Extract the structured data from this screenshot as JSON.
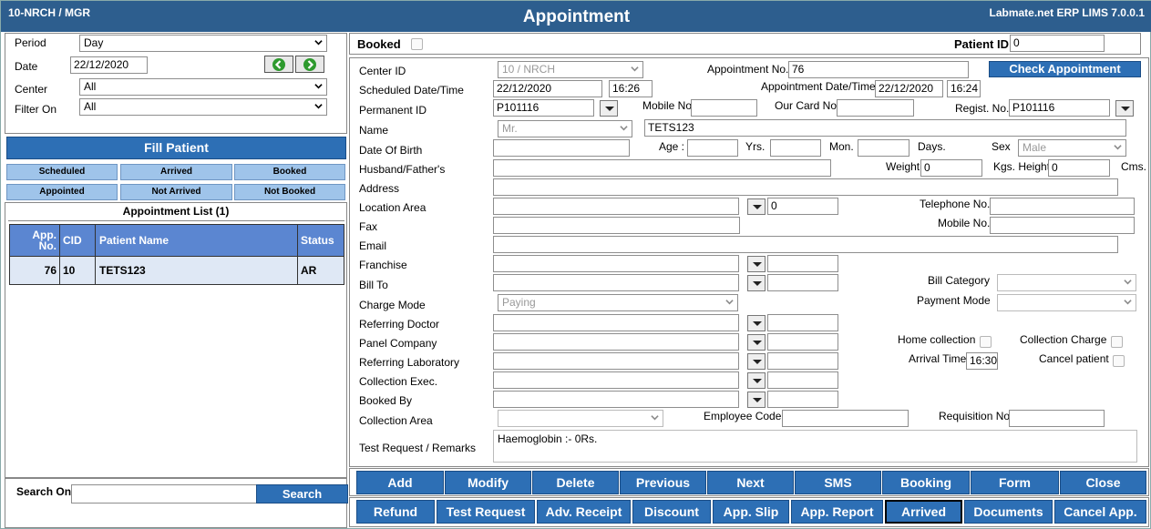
{
  "header": {
    "left": "10-NRCH / MGR",
    "title": "Appointment",
    "right": "Labmate.net ERP LIMS 7.0.0.1"
  },
  "left": {
    "period_label": "Period",
    "period_value": "Day",
    "date_label": "Date",
    "date_value": "22/12/2020",
    "center_label": "Center",
    "center_value": "All",
    "filter_label": "Filter On",
    "filter_value": "All",
    "fill_patient": "Fill Patient",
    "filters": [
      "Scheduled",
      "Arrived",
      "Booked",
      "Appointed",
      "Not Arrived",
      "Not Booked"
    ],
    "list_title": "Appointment List (1)",
    "columns": [
      "App. No.",
      "CID",
      "Patient Name",
      "Status"
    ],
    "rows": [
      {
        "app_no": "76",
        "cid": "10",
        "name": "TETS123",
        "status": "AR"
      }
    ],
    "search_label": "Search On",
    "search_button": "Search"
  },
  "top": {
    "booked_label": "Booked",
    "patient_id_label": "Patient ID",
    "patient_id_value": "0"
  },
  "form": {
    "center_id_label": "Center ID",
    "center_id_value": "10 / NRCH",
    "appointment_no_label": "Appointment No.",
    "appointment_no_value": "76",
    "check_appointment": "Check Appointment",
    "scheduled_label": "Scheduled Date/Time",
    "scheduled_date": "22/12/2020",
    "scheduled_time": "16:26",
    "appt_dt_label": "Appointment Date/Time",
    "appt_date": "22/12/2020",
    "appt_time": "16:24",
    "permanent_id_label": "Permanent ID",
    "permanent_id_value": "P101116",
    "mobile_no_label": "Mobile No",
    "our_card_label": "Our Card No",
    "regist_label": "Regist. No.",
    "regist_value": "P101116",
    "name_label": "Name",
    "title_value": "Mr.",
    "name_value": "TETS123",
    "dob_label": "Date Of Birth",
    "age_label": "Age :",
    "yrs_label": "Yrs.",
    "mon_label": "Mon.",
    "days_label": "Days.",
    "sex_label": "Sex",
    "sex_value": "Male",
    "husband_label": "Husband/Father's",
    "weight_label": "Weight",
    "weight_value": "0",
    "kgs_height_label": "Kgs. Height",
    "height_value": "0",
    "cms_label": "Cms.",
    "address_label": "Address",
    "location_label": "Location Area",
    "location_code": "0",
    "telephone_label": "Telephone No.",
    "fax_label": "Fax",
    "mobile2_label": "Mobile No.",
    "email_label": "Email",
    "franchise_label": "Franchise",
    "bill_to_label": "Bill To",
    "bill_category_label": "Bill Category",
    "charge_mode_label": "Charge Mode",
    "charge_mode_value": "Paying",
    "payment_mode_label": "Payment Mode",
    "referring_doctor_label": "Referring Doctor",
    "panel_company_label": "Panel Company",
    "home_collection_label": "Home collection",
    "collection_charge_label": "Collection Charge",
    "referring_lab_label": "Referring Laboratory",
    "arrival_time_label": "Arrival Time",
    "arrival_time_value": "16:30",
    "cancel_patient_label": "Cancel patient",
    "collection_exec_label": "Collection Exec.",
    "booked_by_label": "Booked By",
    "collection_area_label": "Collection Area",
    "employee_code_label": "Employee Code",
    "requisition_label": "Requisition No",
    "test_request_label": "Test Request / Remarks",
    "test_request_value": "Haemoglobin :-  0Rs."
  },
  "buttons_row1": [
    "Add",
    "Modify",
    "Delete",
    "Previous",
    "Next",
    "SMS",
    "Booking",
    "Form",
    "Close"
  ],
  "buttons_row2": [
    "Refund",
    "Test Request",
    "Adv. Receipt",
    "Discount",
    "App. Slip",
    "App. Report",
    "Arrived",
    "Documents",
    "Cancel App."
  ]
}
